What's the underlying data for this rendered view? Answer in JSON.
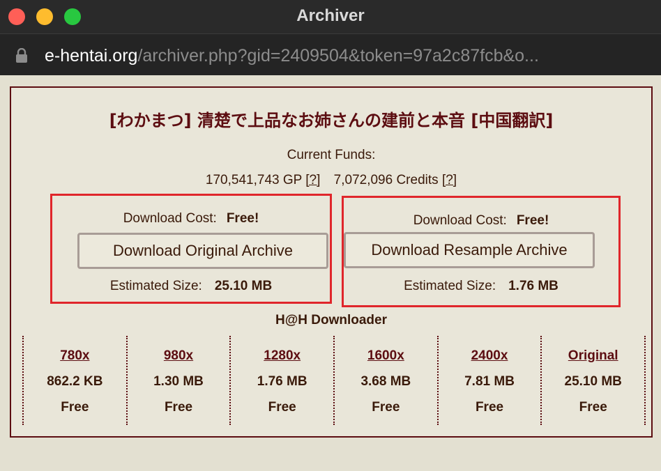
{
  "window": {
    "title": "Archiver"
  },
  "address": {
    "host": "e-hentai.org",
    "path": "/archiver.php?gid=2409504&token=97a2c87fcb&o..."
  },
  "gallery": {
    "title": "[わかまつ] 清楚で上品なお姉さんの建前と本音 [中国翻訳]"
  },
  "funds": {
    "label": "Current Funds:",
    "gp": "170,541,743 GP",
    "gp_help": "[?]",
    "credits": "7,072,096 Credits",
    "credits_help": "[?]"
  },
  "original": {
    "cost_label": "Download Cost:",
    "cost_value": "Free!",
    "button": "Download Original Archive",
    "size_label": "Estimated Size:",
    "size_value": "25.10 MB"
  },
  "resample": {
    "cost_label": "Download Cost:",
    "cost_value": "Free!",
    "button": "Download Resample Archive",
    "size_label": "Estimated Size:",
    "size_value": "1.76 MB"
  },
  "hath": {
    "title": "H@H Downloader",
    "options": [
      {
        "res": "780x",
        "size": "862.2 KB",
        "cost": "Free"
      },
      {
        "res": "980x",
        "size": "1.30 MB",
        "cost": "Free"
      },
      {
        "res": "1280x",
        "size": "1.76 MB",
        "cost": "Free"
      },
      {
        "res": "1600x",
        "size": "3.68 MB",
        "cost": "Free"
      },
      {
        "res": "2400x",
        "size": "7.81 MB",
        "cost": "Free"
      },
      {
        "res": "Original",
        "size": "25.10 MB",
        "cost": "Free"
      }
    ]
  },
  "colors": {
    "accent": "#5c0d11",
    "highlight_box": "#e0262b",
    "panel_bg": "#e9e6d9"
  }
}
